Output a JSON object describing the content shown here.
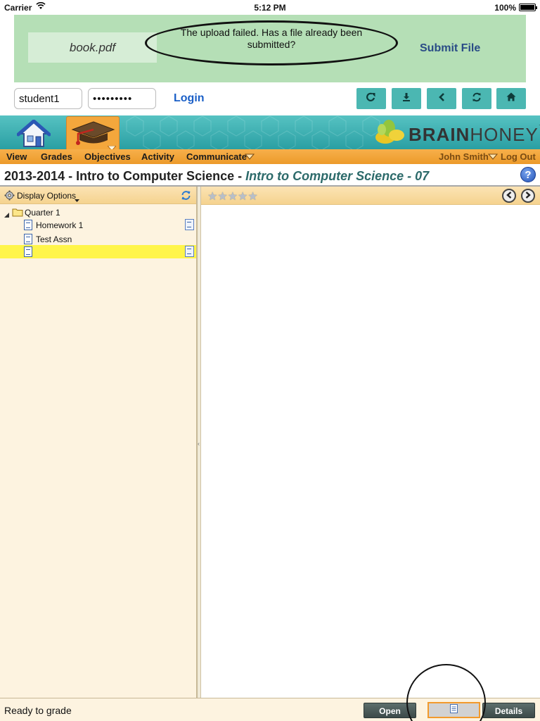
{
  "status_bar": {
    "carrier": "Carrier",
    "time": "5:12 PM",
    "battery": "100%",
    "battery_level": 1.0
  },
  "upload": {
    "file_name": "book.pdf",
    "message": "The upload failed. Has a file already been submitted?",
    "submit_label": "Submit File"
  },
  "login": {
    "username_value": "student1",
    "password_value": "•••••••••",
    "login_label": "Login"
  },
  "nav_icons": [
    "external-link-icon",
    "download-icon",
    "back-icon",
    "refresh-icon",
    "home-icon"
  ],
  "logo": {
    "bold": "BRAIN",
    "thin": "HONEY",
    "tm": "™"
  },
  "menu": {
    "view": "View",
    "grades": "Grades",
    "objectives": "Objectives",
    "activity": "Activity",
    "communicate": "Communicate",
    "user": "John Smith",
    "logout": "Log Out"
  },
  "course": {
    "title": "2013-2014 - Intro to Computer Science - ",
    "subtitle": "Intro to Computer Science - 07"
  },
  "tree": {
    "display_options": "Display Options",
    "folder": "Quarter 1",
    "items": [
      {
        "label": "Homework 1"
      },
      {
        "label": "Test Assn"
      },
      {
        "label": ""
      }
    ]
  },
  "rating": {
    "stars": "★★★★★",
    "max": 5
  },
  "bottom": {
    "status": "Ready to grade",
    "open_label": "Open",
    "details_label": "Details"
  },
  "colors": {
    "upload_bg": "#b5dfb6",
    "header_teal": "#2a9fa3",
    "menu_orange": "#ec9a2a",
    "panel_cream": "#fdf3e0",
    "selected_yellow": "#fff54a",
    "link_blue": "#1a5fc7"
  }
}
